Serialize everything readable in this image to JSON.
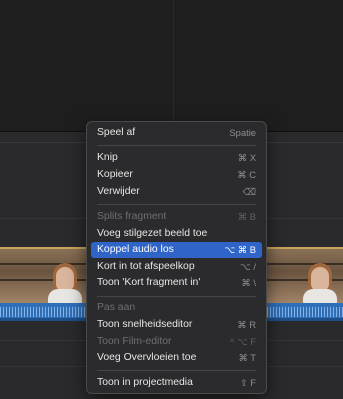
{
  "menu": {
    "items": [
      {
        "label": "Speel af",
        "shortcut": "Spatie",
        "disabled": false
      },
      {
        "label": "Knip",
        "shortcut": "⌘ X",
        "disabled": false
      },
      {
        "label": "Kopieer",
        "shortcut": "⌘ C",
        "disabled": false
      },
      {
        "label": "Verwijder",
        "shortcut": "⌫",
        "disabled": false
      },
      {
        "label": "Splits fragment",
        "shortcut": "⌘ B",
        "disabled": true
      },
      {
        "label": "Voeg stilgezet beeld toe",
        "shortcut": "",
        "disabled": false
      },
      {
        "label": "Koppel audio los",
        "shortcut": "⌥ ⌘ B",
        "disabled": false,
        "highlighted": true
      },
      {
        "label": "Kort in tot afspeelkop",
        "shortcut": "⌥ /",
        "disabled": false
      },
      {
        "label": "Toon 'Kort fragment in'",
        "shortcut": "⌘ \\",
        "disabled": false
      },
      {
        "label": "Pas aan",
        "shortcut": "",
        "disabled": true
      },
      {
        "label": "Toon snelheidseditor",
        "shortcut": "⌘ R",
        "disabled": false
      },
      {
        "label": "Toon Film-editor",
        "shortcut": "^ ⌥ F",
        "disabled": true
      },
      {
        "label": "Voeg Overvloeien toe",
        "shortcut": "⌘ T",
        "disabled": false
      },
      {
        "label": "Toon in projectmedia",
        "shortcut": "⇧ F",
        "disabled": false
      }
    ]
  },
  "colors": {
    "highlight": "#2f64c9",
    "audio_track": "#2f6fb8",
    "clip_border": "#c9a45c"
  }
}
